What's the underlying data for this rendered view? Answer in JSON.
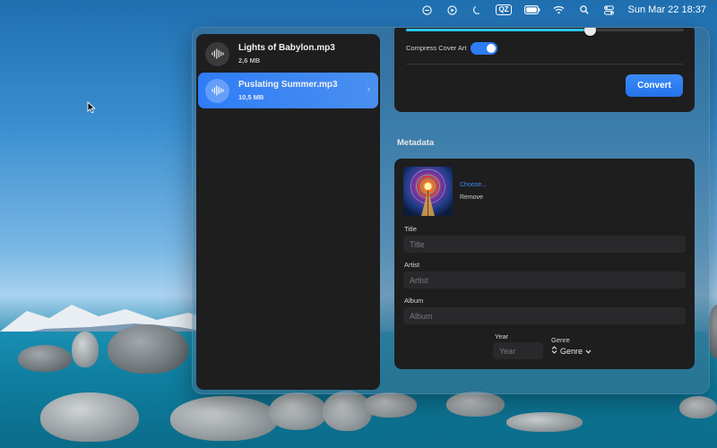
{
  "menubar": {
    "icons": [
      "minus-circle-icon",
      "play-circle-icon",
      "moon-icon",
      "qz-badge",
      "battery-icon",
      "wifi-icon",
      "search-icon",
      "control-center-icon"
    ],
    "badge_text": "QZ",
    "datetime": "Sun Mar 22  18:37"
  },
  "files": [
    {
      "name": "Lights of Babylon.mp3",
      "size": "2,6 MB",
      "selected": false
    },
    {
      "name": "Puslating Summer.mp3",
      "size": "10,5 MB",
      "selected": true
    }
  ],
  "settings": {
    "quality_slider_value": 0.66,
    "compress_label": "Compress Cover Art",
    "compress_enabled": true,
    "convert_label": "Convert"
  },
  "metadata": {
    "section_title": "Metadata",
    "choose_label": "Choose...",
    "remove_label": "Remove",
    "title_label": "Title",
    "title_placeholder": "Title",
    "artist_label": "Artist",
    "artist_placeholder": "Artist",
    "album_label": "Album",
    "album_placeholder": "Album",
    "year_label": "Year",
    "year_placeholder": "Year",
    "genre_label": "Genre",
    "genre_value": "Genre"
  },
  "colors": {
    "accent": "#2f7cf6",
    "slider_fill": "#2ec5e8",
    "card_bg": "#1e1e1f"
  }
}
